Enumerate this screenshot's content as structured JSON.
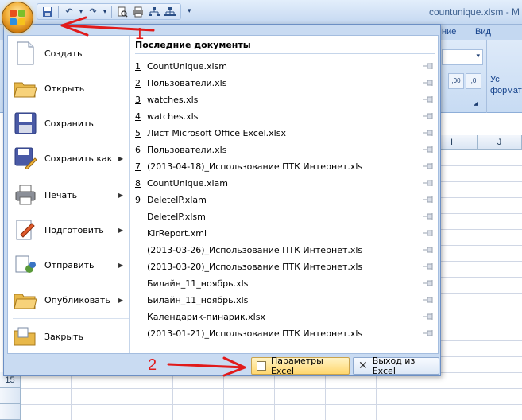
{
  "window": {
    "doc_title": "countunique.xlsm - M"
  },
  "ribbon": {
    "tabs": [
      "ние",
      "Вид"
    ],
    "side_labels": [
      "Ус",
      "форматр"
    ],
    "dec_buttons": [
      ",00",
      ",0"
    ]
  },
  "sheet": {
    "columns": [
      "I",
      "J"
    ],
    "row_number": "15"
  },
  "menu": {
    "left_items": [
      {
        "label": "Создать",
        "icon": "new-document-icon",
        "has_arrow": false
      },
      {
        "label": "Открыть",
        "icon": "open-folder-icon",
        "has_arrow": false
      },
      {
        "label": "Сохранить",
        "icon": "floppy-save-icon",
        "has_arrow": false
      },
      {
        "label": "Сохранить как",
        "icon": "save-as-icon",
        "has_arrow": true
      },
      {
        "label": "Печать",
        "icon": "printer-icon",
        "has_arrow": true
      },
      {
        "label": "Подготовить",
        "icon": "prepare-icon",
        "has_arrow": true
      },
      {
        "label": "Отправить",
        "icon": "send-icon",
        "has_arrow": true
      },
      {
        "label": "Опубликовать",
        "icon": "publish-icon",
        "has_arrow": true
      },
      {
        "label": "Закрыть",
        "icon": "close-folder-icon",
        "has_arrow": false
      }
    ],
    "recent_header": "Последние документы",
    "recent": [
      {
        "num": "1",
        "name": "CountUnique.xlsm"
      },
      {
        "num": "2",
        "name": "Пользователи.xls"
      },
      {
        "num": "3",
        "name": "watches.xls"
      },
      {
        "num": "4",
        "name": "watches.xls"
      },
      {
        "num": "5",
        "name": "Лист Microsoft Office Excel.xlsx"
      },
      {
        "num": "6",
        "name": "Пользователи.xls"
      },
      {
        "num": "7",
        "name": "(2013-04-18)_Использование ПТК Интернет.xls"
      },
      {
        "num": "8",
        "name": "CountUnique.xlam"
      },
      {
        "num": "9",
        "name": "DeleteIP.xlam"
      },
      {
        "num": "",
        "name": "DeleteIP.xlsm"
      },
      {
        "num": "",
        "name": "KirReport.xml"
      },
      {
        "num": "",
        "name": "(2013-03-26)_Использование ПТК Интернет.xls"
      },
      {
        "num": "",
        "name": "(2013-03-20)_Использование ПТК Интернет.xls"
      },
      {
        "num": "",
        "name": "Билайн_11_ноябрь.xls"
      },
      {
        "num": "",
        "name": "Билайн_11_ноябрь.xls"
      },
      {
        "num": "",
        "name": "Календарик-пинарик.xlsx"
      },
      {
        "num": "",
        "name": "(2013-01-21)_Использование ПТК Интернет.xls"
      }
    ],
    "options_button": "Параметры Excel",
    "exit_button": "Выход из Excel"
  },
  "annotations": {
    "one": "1",
    "two": "2"
  },
  "colors": {
    "annotation": "#e11b1b",
    "office_orange": "#f3b13a"
  }
}
